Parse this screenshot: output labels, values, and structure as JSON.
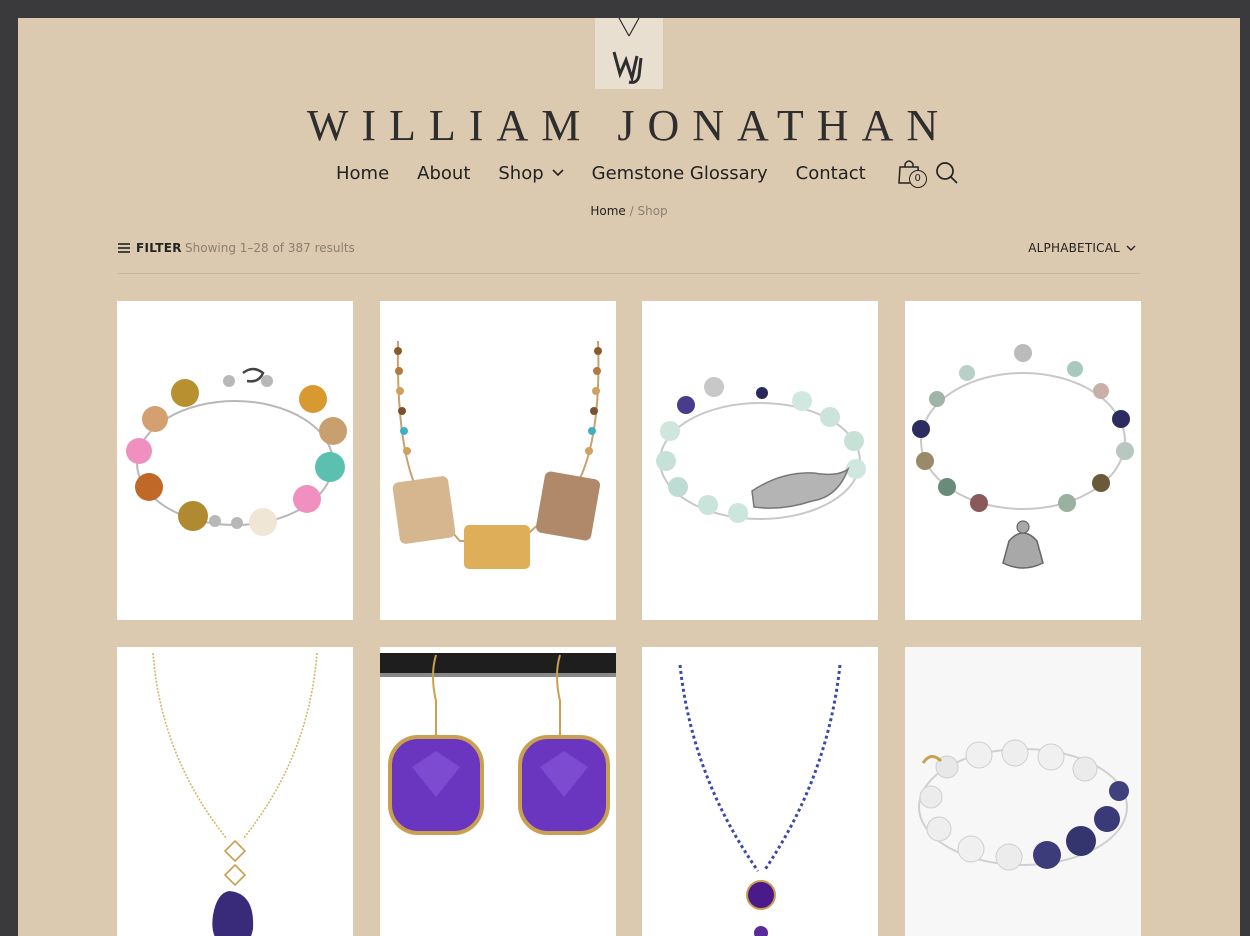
{
  "brand": {
    "name": "WILLIAM JONATHAN",
    "logo_mark": "WJ"
  },
  "nav": {
    "items": [
      {
        "label": "Home"
      },
      {
        "label": "About"
      },
      {
        "label": "Shop",
        "has_dropdown": true
      },
      {
        "label": "Gemstone Glossary"
      },
      {
        "label": "Contact"
      }
    ],
    "cart_count": "0",
    "icons": [
      "cart-icon",
      "search-icon",
      "chevron-down-icon"
    ]
  },
  "breadcrumb": {
    "home": "Home",
    "separator": "/",
    "current": "Shop"
  },
  "toolbar": {
    "filter_label": "FILTER",
    "result_count": "Showing 1–28 of 387 results",
    "sort_label": "ALPHABETICAL"
  },
  "colors": {
    "page_background": "#dccab0",
    "outer_background": "#3a3a3c",
    "text": "#222222",
    "muted_text": "#8a7f70",
    "card_background": "#ffffff"
  },
  "products": [
    {
      "image": "multicolor-beaded-bracelet"
    },
    {
      "image": "agate-bead-necklace"
    },
    {
      "image": "aquamarine-bracelet-with-silver-charm"
    },
    {
      "image": "gemstone-bracelet-with-buddha-charm"
    },
    {
      "image": "gold-chain-druzy-pendant-necklace"
    },
    {
      "image": "amethyst-drop-earrings"
    },
    {
      "image": "beaded-chain-amethyst-pendant"
    },
    {
      "image": "pearl-and-iolite-bracelet"
    }
  ]
}
